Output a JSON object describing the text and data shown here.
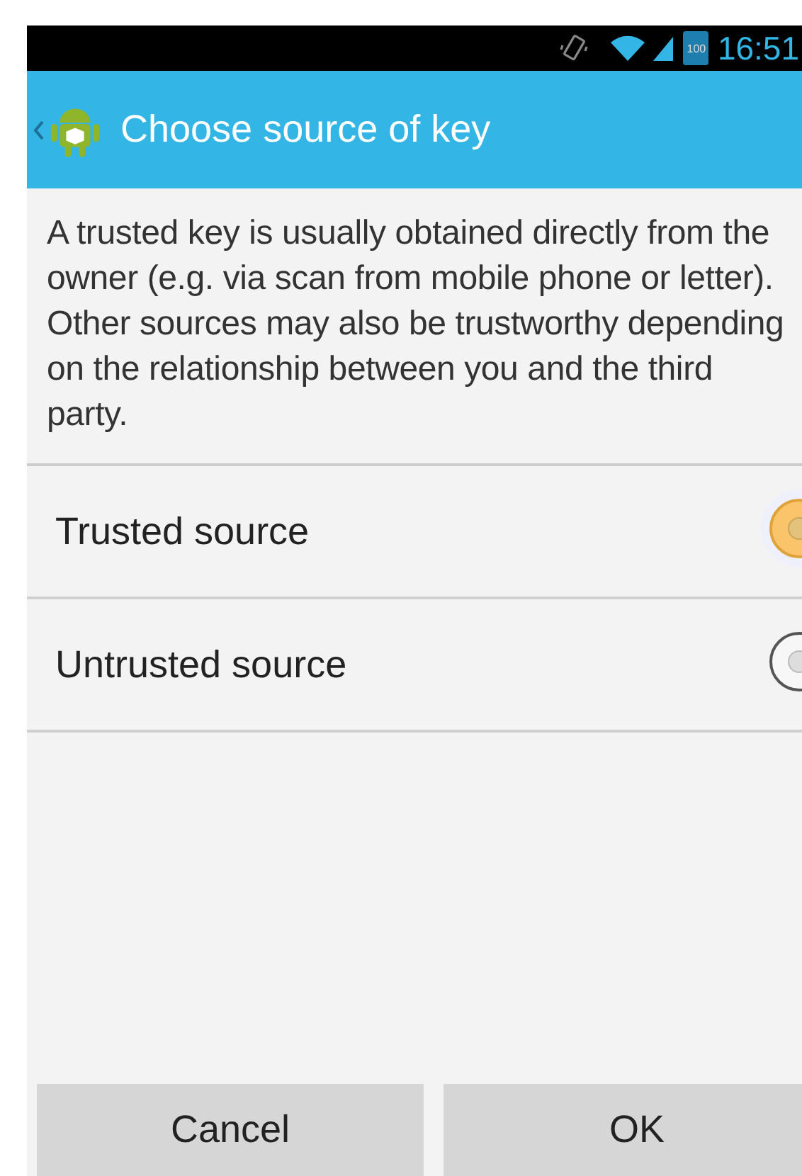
{
  "status_bar": {
    "battery": "100",
    "time": "16:51"
  },
  "action_bar": {
    "title": "Choose source of key"
  },
  "description": "A trusted key is usually obtained directly from the owner (e.g. via scan from mobile phone or letter).\nOther sources may also be trustworthy depending on the relationship between you and the third party.",
  "options": [
    {
      "label": "Trusted source",
      "selected": true
    },
    {
      "label": "Untrusted source",
      "selected": false
    }
  ],
  "buttons": [
    "Cancel",
    "OK"
  ]
}
